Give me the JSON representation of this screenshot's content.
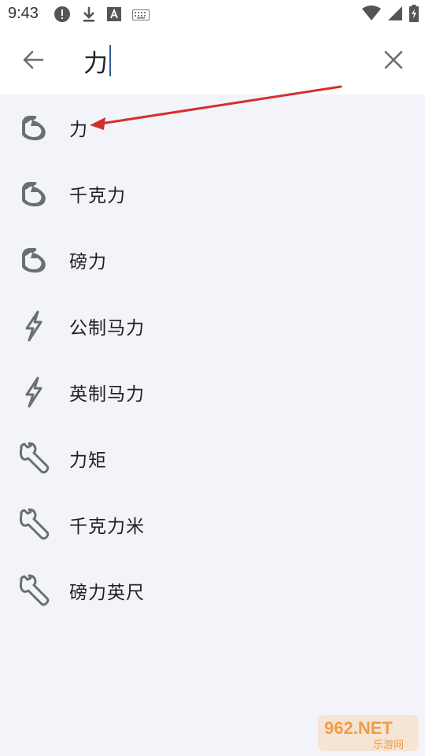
{
  "status_bar": {
    "time": "9:43",
    "left_icons": [
      "alert-circle-icon",
      "download-icon",
      "font-a-icon",
      "keyboard-icon"
    ],
    "right_icons": [
      "wifi-icon",
      "signal-icon",
      "battery-icon"
    ]
  },
  "search": {
    "query": "力"
  },
  "results": [
    {
      "label": "力",
      "icon": "flexed-arm-icon"
    },
    {
      "label": "千克力",
      "icon": "flexed-arm-icon"
    },
    {
      "label": "磅力",
      "icon": "flexed-arm-icon"
    },
    {
      "label": "公制马力",
      "icon": "lightning-icon"
    },
    {
      "label": "英制马力",
      "icon": "lightning-icon"
    },
    {
      "label": "力矩",
      "icon": "wrench-icon"
    },
    {
      "label": "千克力米",
      "icon": "wrench-icon"
    },
    {
      "label": "磅力英尺",
      "icon": "wrench-icon"
    }
  ],
  "colors": {
    "background": "#f2f4f9",
    "bar": "#ffffff",
    "icon": "#6b6e73",
    "caret": "#2f5f93",
    "annotation": "#d32f2f"
  },
  "watermark": {
    "text_top": "962.NET",
    "text_bottom": "乐游网"
  }
}
